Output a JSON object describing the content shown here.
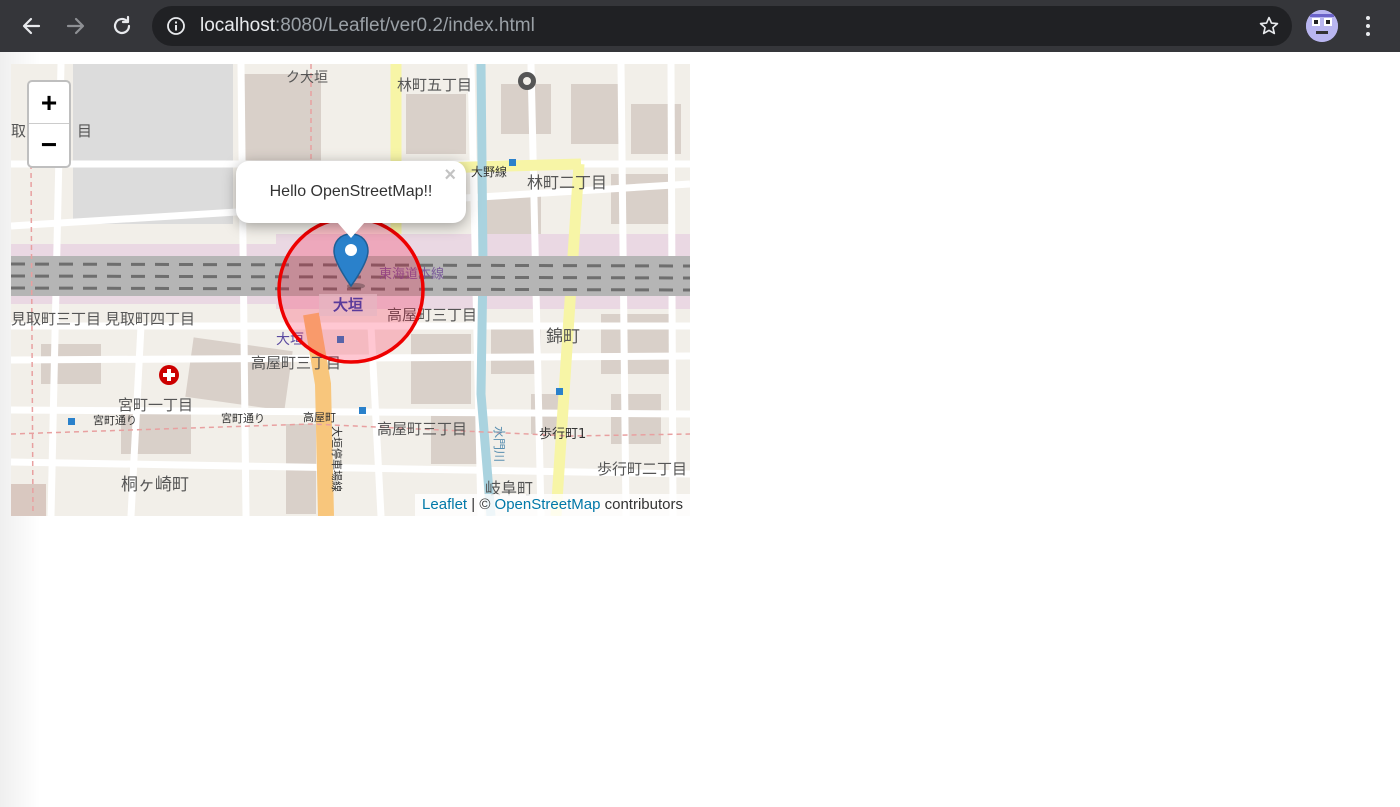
{
  "browser": {
    "url_host": "localhost",
    "url_rest": ":8080/Leaflet/ver0.2/index.html"
  },
  "map": {
    "zoom_in_label": "+",
    "zoom_out_label": "−",
    "popup_text": "Hello OpenStreetMap!!",
    "popup_close_label": "×",
    "attribution": {
      "leaflet_link": "Leaflet",
      "separator": " | © ",
      "osm_link": "OpenStreetMap",
      "suffix": " contributors"
    },
    "labels": {
      "kudaigaki": "ク大垣",
      "hayashi5": "林町五丁目",
      "hayashi2": "林町二丁目",
      "oono_line": "大野線",
      "tokaido": "東海道本線",
      "ogaki_station": "大垣",
      "ogaki_bus": "大垣",
      "mitori3": "見取町三丁目",
      "mitori4": "見取町四丁目",
      "takaya3_a": "高屋町三丁目",
      "takaya3_b": "高屋町三丁目",
      "takaya3_c": "高屋町三丁目",
      "nishiki": "錦町",
      "miya1": "宮町一丁目",
      "miya_dori_a": "宮町通り",
      "miya_dori_b": "宮町通り",
      "takaya_stop": "高屋町",
      "ogaki_ekimae": "大垣停車場線",
      "suimon": "水門川",
      "hoko1": "歩行町1",
      "hoko2": "歩行町二丁目",
      "kirigasaki": "桐ヶ崎町",
      "gifu": "岐阜町",
      "tori_left": "取町",
      "me_left": "目"
    }
  },
  "colors": {
    "map_bg": "#f2efe9",
    "road": "#ffffff",
    "primary_road": "#f7f5a6",
    "trunk_road": "#f8c67c",
    "rail": "#8a8a8a",
    "building": "#d9d0c9",
    "water": "#aad3df",
    "circle": "#ee0000",
    "marker": "#2a81cb",
    "link": "#0078a8"
  }
}
